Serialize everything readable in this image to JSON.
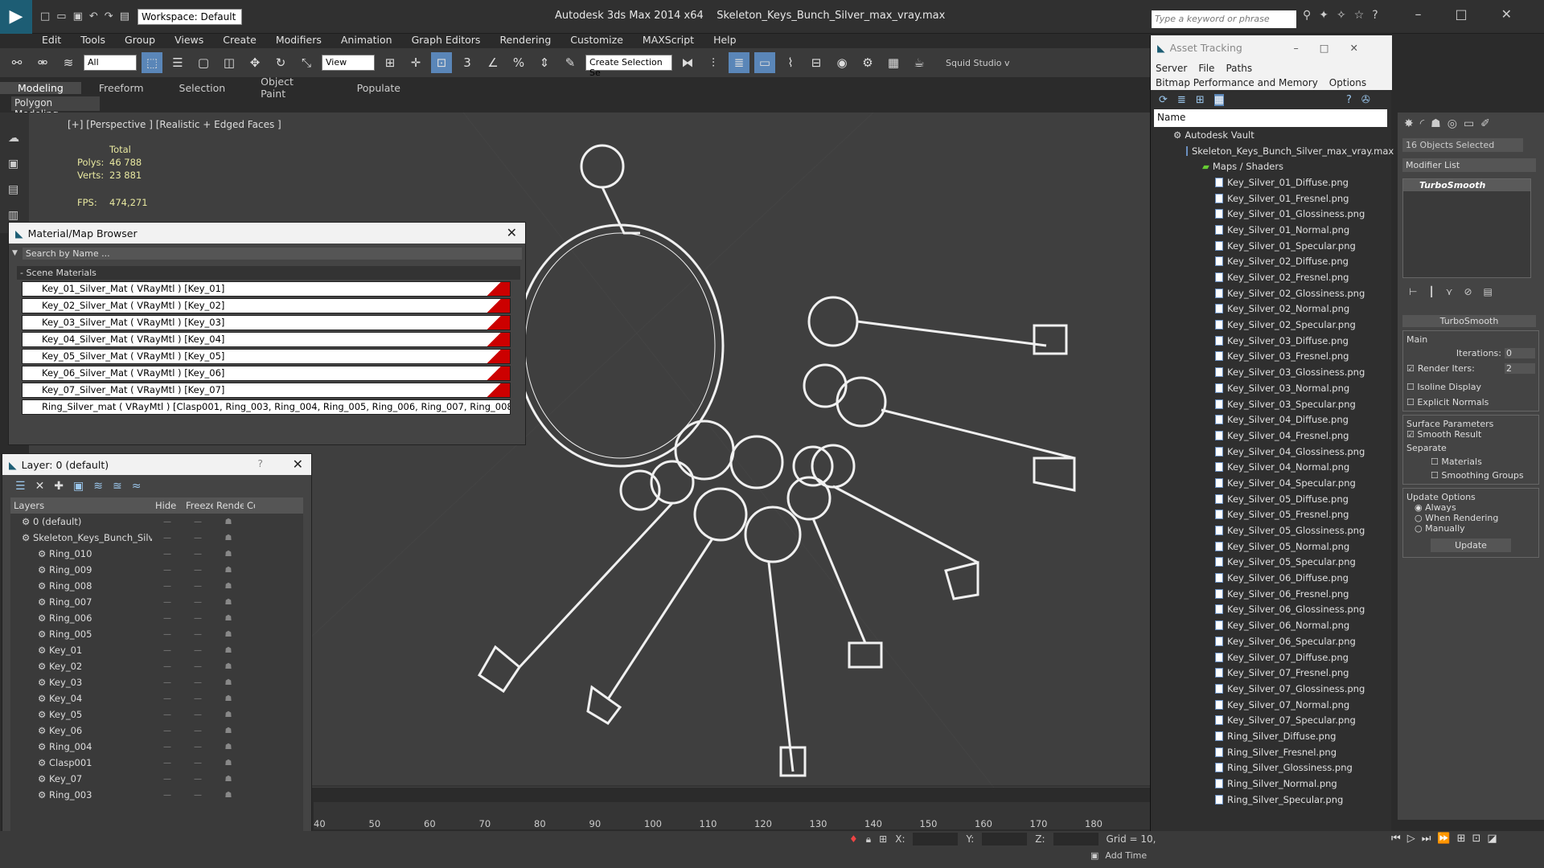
{
  "app": {
    "title": "Autodesk 3ds Max  2014 x64",
    "file": "Skeleton_Keys_Bunch_Silver_max_vray.max",
    "workspace": "Workspace: Default",
    "keyword_placeholder": "Type a keyword or phrase"
  },
  "menu": [
    "Edit",
    "Tools",
    "Group",
    "Views",
    "Create",
    "Modifiers",
    "Animation",
    "Graph Editors",
    "Rendering",
    "Customize",
    "MAXScript",
    "Help"
  ],
  "toolbar": {
    "filter": "All",
    "view": "View",
    "selection_set": "Create Selection Se",
    "squid": "Squid Studio v"
  },
  "ribbon": {
    "tabs": [
      "Modeling",
      "Freeform",
      "Selection",
      "Object Paint",
      "Populate"
    ],
    "sub": "Polygon Modeling"
  },
  "viewport": {
    "label": "[+] [Perspective ] [Realistic + Edged Faces ]",
    "total": "Total",
    "polys_label": "Polys:",
    "polys": "46 788",
    "verts_label": "Verts:",
    "verts": "23 881",
    "fps_label": "FPS:",
    "fps": "474,271"
  },
  "material_browser": {
    "title": "Material/Map Browser",
    "search": "Search by Name ...",
    "section": "- Scene Materials",
    "items": [
      "Key_01_Silver_Mat  ( VRayMtl ) [Key_01]",
      "Key_02_Silver_Mat  ( VRayMtl ) [Key_02]",
      "Key_03_Silver_Mat  ( VRayMtl ) [Key_03]",
      "Key_04_Silver_Mat  ( VRayMtl ) [Key_04]",
      "Key_05_Silver_Mat  ( VRayMtl ) [Key_05]",
      "Key_06_Silver_Mat  ( VRayMtl ) [Key_06]",
      "Key_07_Silver_Mat  ( VRayMtl ) [Key_07]",
      "Ring_Silver_mat  ( VRayMtl ) [Clasp001, Ring_003, Ring_004, Ring_005, Ring_006, Ring_007, Ring_008, Ring_00..."
    ]
  },
  "layers": {
    "title": "Layer: 0 (default)",
    "columns": [
      "Layers",
      "Hide",
      "Freeze",
      "Render",
      "Co"
    ],
    "rows": [
      "0 (default)",
      "Skeleton_Keys_Bunch_Silver",
      "Ring_010",
      "Ring_009",
      "Ring_008",
      "Ring_007",
      "Ring_006",
      "Ring_005",
      "Key_01",
      "Key_02",
      "Key_03",
      "Key_04",
      "Key_05",
      "Key_06",
      "Ring_004",
      "Clasp001",
      "Key_07",
      "Ring_003"
    ]
  },
  "asset_tracking": {
    "title": "Asset Tracking",
    "menu": [
      "Server",
      "File",
      "Paths"
    ],
    "menu2": [
      "Bitmap Performance and Memory",
      "Options"
    ],
    "column": "Name",
    "vault": "Autodesk Vault",
    "file": "Skeleton_Keys_Bunch_Silver_max_vray.max",
    "folder": "Maps / Shaders",
    "maps": [
      "Key_Silver_01_Diffuse.png",
      "Key_Silver_01_Fresnel.png",
      "Key_Silver_01_Glossiness.png",
      "Key_Silver_01_Normal.png",
      "Key_Silver_01_Specular.png",
      "Key_Silver_02_Diffuse.png",
      "Key_Silver_02_Fresnel.png",
      "Key_Silver_02_Glossiness.png",
      "Key_Silver_02_Normal.png",
      "Key_Silver_02_Specular.png",
      "Key_Silver_03_Diffuse.png",
      "Key_Silver_03_Fresnel.png",
      "Key_Silver_03_Glossiness.png",
      "Key_Silver_03_Normal.png",
      "Key_Silver_03_Specular.png",
      "Key_Silver_04_Diffuse.png",
      "Key_Silver_04_Fresnel.png",
      "Key_Silver_04_Glossiness.png",
      "Key_Silver_04_Normal.png",
      "Key_Silver_04_Specular.png",
      "Key_Silver_05_Diffuse.png",
      "Key_Silver_05_Fresnel.png",
      "Key_Silver_05_Glossiness.png",
      "Key_Silver_05_Normal.png",
      "Key_Silver_05_Specular.png",
      "Key_Silver_06_Diffuse.png",
      "Key_Silver_06_Fresnel.png",
      "Key_Silver_06_Glossiness.png",
      "Key_Silver_06_Normal.png",
      "Key_Silver_06_Specular.png",
      "Key_Silver_07_Diffuse.png",
      "Key_Silver_07_Fresnel.png",
      "Key_Silver_07_Glossiness.png",
      "Key_Silver_07_Normal.png",
      "Key_Silver_07_Specular.png",
      "Ring_Silver_Diffuse.png",
      "Ring_Silver_Fresnel.png",
      "Ring_Silver_Glossiness.png",
      "Ring_Silver_Normal.png",
      "Ring_Silver_Specular.png"
    ]
  },
  "command_panel": {
    "selected": "16 Objects Selected",
    "modifier_list": "Modifier List",
    "stack_item": "TurboSmooth",
    "rollout": "TurboSmooth",
    "main": "Main",
    "iterations_label": "Iterations:",
    "iterations": "0",
    "render_iters_label": "Render Iters:",
    "render_iters": "2",
    "isoline": "Isoline Display",
    "explicit": "Explicit Normals",
    "surface": "Surface Parameters",
    "smooth_result": "Smooth Result",
    "separate": "Separate",
    "materials": "Materials",
    "smoothing_groups": "Smoothing Groups",
    "update_options": "Update Options",
    "always": "Always",
    "when_rendering": "When Rendering",
    "manually": "Manually",
    "update": "Update"
  },
  "timeline": {
    "ticks": [
      "40",
      "50",
      "60",
      "70",
      "80",
      "90",
      "100",
      "110",
      "120",
      "130",
      "140",
      "150",
      "160",
      "170",
      "180"
    ]
  },
  "status": {
    "x": "X:",
    "y": "Y:",
    "z": "Z:",
    "grid": "Grid = 10,",
    "add_time": "Add Time"
  },
  "colors": {
    "accent": "#1d5d74",
    "material_swatch": "#c00000",
    "stats_text": "#e8e8a0"
  }
}
